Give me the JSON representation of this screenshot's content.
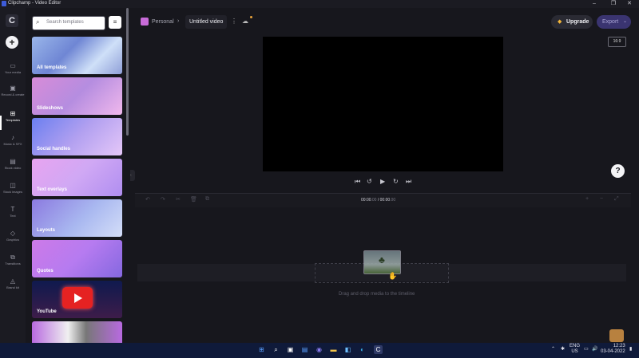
{
  "window": {
    "title": "Clipchamp - Video Editor",
    "controls": [
      "–",
      "❐",
      "✕"
    ]
  },
  "rail": {
    "logo": "C",
    "add": "+",
    "items": [
      {
        "label": "Your media",
        "icon": "folder-icon"
      },
      {
        "label": "Record & create",
        "icon": "camera-icon"
      },
      {
        "label": "Templates",
        "icon": "grid-icon"
      },
      {
        "label": "Music & SFX",
        "icon": "music-icon"
      },
      {
        "label": "Stock video",
        "icon": "film-icon"
      },
      {
        "label": "Stock images",
        "icon": "image-icon"
      },
      {
        "label": "Text",
        "icon": "text-icon"
      },
      {
        "label": "Graphics",
        "icon": "shapes-icon"
      },
      {
        "label": "Transitions",
        "icon": "transitions-icon"
      },
      {
        "label": "Brand kit",
        "icon": "brand-icon"
      }
    ]
  },
  "panel": {
    "search_placeholder": "Search templates",
    "cards": [
      {
        "label": "All templates"
      },
      {
        "label": "Slideshows"
      },
      {
        "label": "Social handles"
      },
      {
        "label": "Text overlays"
      },
      {
        "label": "Layouts"
      },
      {
        "label": "Quotes"
      },
      {
        "label": "YouTube"
      },
      {
        "label": ""
      }
    ]
  },
  "header": {
    "project": "Personal",
    "video_title": "Untitled video",
    "upgrade": "Upgrade",
    "export": "Export"
  },
  "preview": {
    "ratio": "16:9",
    "help": "?"
  },
  "timeline": {
    "time_current": "00:00",
    "time_current_frac": ".00",
    "separator": " / ",
    "time_total": "00:00",
    "time_total_frac": ".00",
    "hint": "Drag and drop media to the timeline"
  },
  "taskbar": {
    "lang_top": "ENG",
    "lang_bottom": "US",
    "time": "12:23",
    "date": "03-04-2022"
  },
  "colors": {
    "accent": "#3a3470",
    "background": "#17171d",
    "taskbar": "#0f1a3a"
  }
}
